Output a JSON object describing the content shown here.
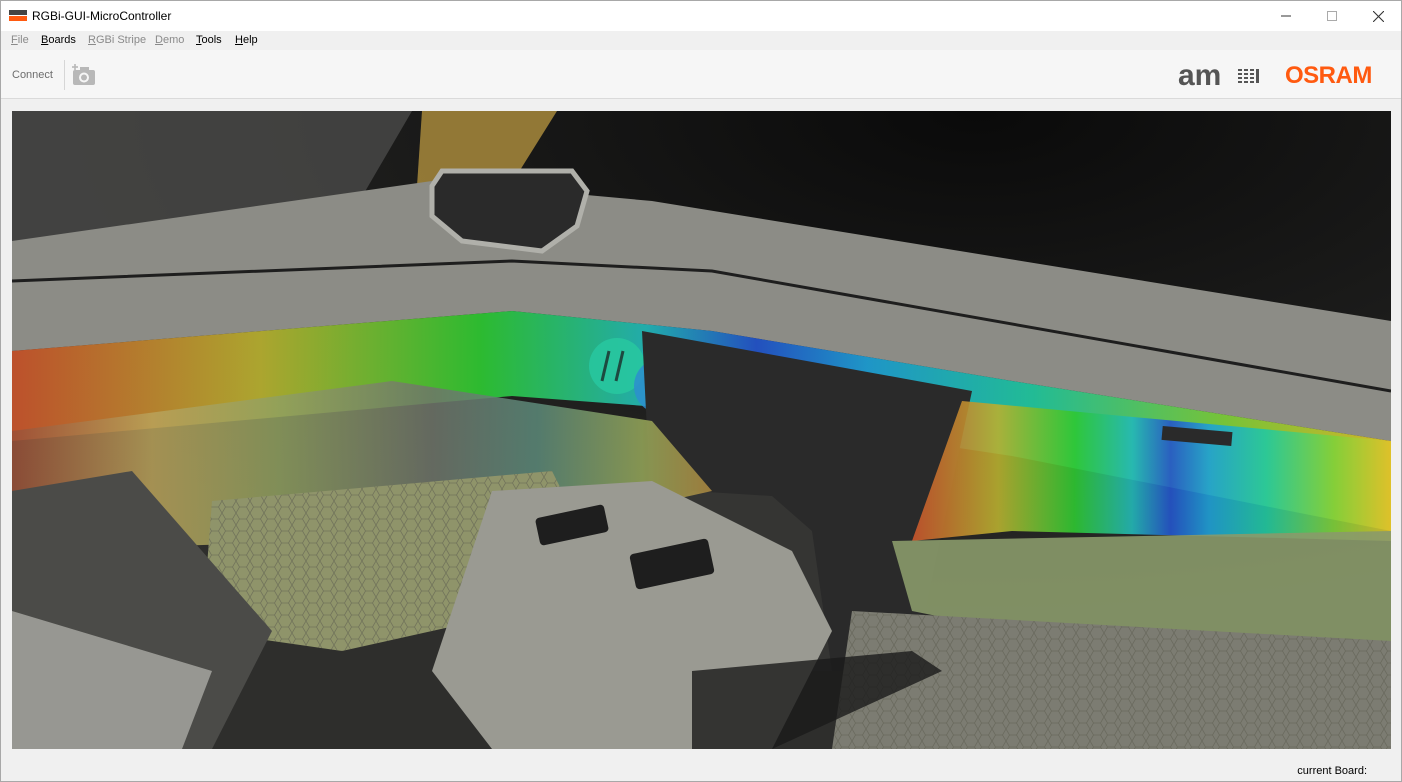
{
  "window": {
    "title": "RGBi-GUI-MicroController"
  },
  "menu": {
    "items": [
      {
        "label": "File",
        "enabled": false
      },
      {
        "label": "Boards",
        "enabled": true,
        "highlighted": true
      },
      {
        "label": "RGBi Stripe",
        "enabled": false
      },
      {
        "label": "Demo",
        "enabled": false
      },
      {
        "label": "Tools",
        "enabled": true
      },
      {
        "label": "Help",
        "enabled": true
      }
    ]
  },
  "toolbar": {
    "connect_label": "Connect",
    "snapshot_icon": "camera-add-icon"
  },
  "branding": {
    "ams_logo": "am",
    "osram_logo": "OSRAM",
    "osram_color": "#ff5a10",
    "highlight_color": "#e8000d"
  },
  "status": {
    "current_board_label": "current Board:"
  }
}
